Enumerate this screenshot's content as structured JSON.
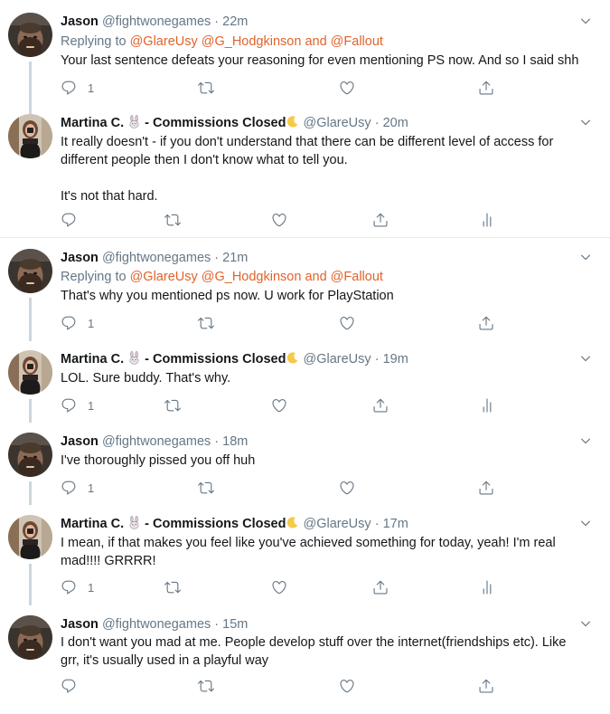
{
  "tweets": [
    {
      "name": "Jason",
      "handle": "@fightwonegames",
      "time": "22m",
      "replying_prefix": "Replying to",
      "replying_mentions": [
        "@GlareUsy",
        "@G_Hodgkinson"
      ],
      "replying_and": "and",
      "replying_last": "@Fallout",
      "lines": [
        "Your last sentence defeats your reasoning for even mentioning PS now. And so I said shh"
      ],
      "reply_count": "1"
    },
    {
      "name": "Martina C.",
      "name_suffix": "- Commissions Closed",
      "handle": "@GlareUsy",
      "time": "20m",
      "lines": [
        "It really doesn't - if you don't understand that there can be different level of access for",
        "different people then I don't know what to tell you."
      ],
      "lines2": [
        "It's not that hard."
      ],
      "reply_count": ""
    },
    {
      "name": "Jason",
      "handle": "@fightwonegames",
      "time": "21m",
      "replying_prefix": "Replying to",
      "replying_mentions": [
        "@GlareUsy",
        "@G_Hodgkinson"
      ],
      "replying_and": "and",
      "replying_last": "@Fallout",
      "lines": [
        "That's why you mentioned ps now. U work for PlayStation"
      ],
      "reply_count": "1"
    },
    {
      "name": "Martina C.",
      "name_suffix": "- Commissions Closed",
      "handle": "@GlareUsy",
      "time": "19m",
      "lines": [
        "LOL. Sure buddy. That's why."
      ],
      "reply_count": "1"
    },
    {
      "name": "Jason",
      "handle": "@fightwonegames",
      "time": "18m",
      "lines": [
        "I've thoroughly pissed you off huh"
      ],
      "reply_count": "1"
    },
    {
      "name": "Martina C.",
      "name_suffix": "- Commissions Closed",
      "handle": "@GlareUsy",
      "time": "17m",
      "lines": [
        "I mean, if that makes you feel like you've achieved something for today, yeah! I'm real",
        "mad!!!! GRRRR!"
      ],
      "reply_count": "1"
    },
    {
      "name": "Jason",
      "handle": "@fightwonegames",
      "time": "15m",
      "lines": [
        "I don't want you mad at me. People develop stuff over the internet(friendships etc). Like",
        "grr, it's usually used in a playful way"
      ],
      "reply_count": ""
    }
  ],
  "separator": "·",
  "icons": {
    "reply": "reply-icon",
    "retweet": "retweet-icon",
    "like": "heart-icon",
    "share": "share-icon",
    "stats": "analytics-icon",
    "caret": "chevron-down-icon",
    "rabbit": "rabbit-emoji-icon",
    "moon": "crescent-moon-emoji-icon"
  },
  "colors": {
    "text": "#14171a",
    "secondary": "#657786",
    "mention": "#e1632b",
    "divider": "#e6ecf0",
    "thread_line": "#ccd6dd"
  }
}
